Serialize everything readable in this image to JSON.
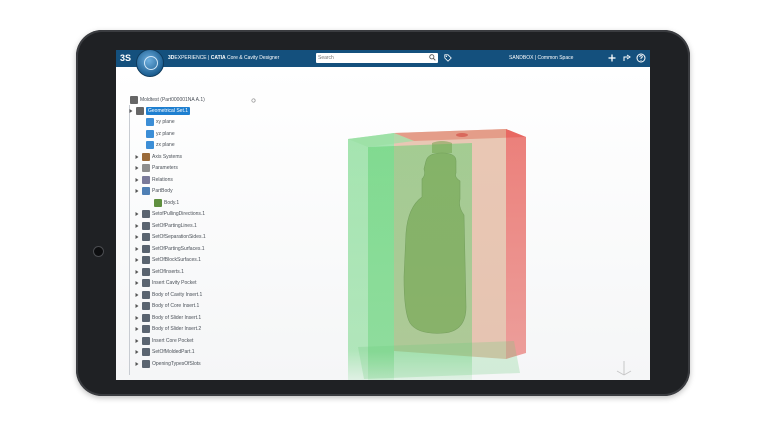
{
  "header": {
    "ds_logo": "3S",
    "brand_3d": "3D",
    "brand_experience": "EXPERIENCE",
    "brand_separator": " | ",
    "brand_catia": "CATIA",
    "brand_app": " Core & Cavity Designer",
    "search_placeholder": "Search",
    "workspace": "SANDBOX | Common Space"
  },
  "tree": {
    "root": "Moldtest (Part000001NA A.1)",
    "selected": "Geometrical Set.1",
    "items": [
      {
        "label": "xy plane",
        "icon": "plane-icon"
      },
      {
        "label": "yz plane",
        "icon": "plane-icon"
      },
      {
        "label": "zx plane",
        "icon": "plane-icon"
      },
      {
        "label": "Axis Systems",
        "icon": "axis-icon"
      },
      {
        "label": "Parameters",
        "icon": "parameters-icon"
      },
      {
        "label": "Relations",
        "icon": "relations-icon"
      },
      {
        "label": "PartBody",
        "icon": "partbody-icon"
      },
      {
        "label": "Body.1",
        "icon": "body-icon"
      },
      {
        "label": "SetofPullingDirections.1",
        "icon": "set-icon"
      },
      {
        "label": "SetOfPartingLines.1",
        "icon": "set-icon"
      },
      {
        "label": "SetOfSeparationSides.1",
        "icon": "set-icon"
      },
      {
        "label": "SetOfPartingSurfaces.1",
        "icon": "set-icon"
      },
      {
        "label": "SetOfBlockSurfaces.1",
        "icon": "set-icon"
      },
      {
        "label": "SetOfInserts.1",
        "icon": "set-icon"
      },
      {
        "label": "Insert Cavity Pocket",
        "icon": "set-icon"
      },
      {
        "label": "Body of Cavity Insert.1",
        "icon": "set-icon"
      },
      {
        "label": "Body of Core Insert.1",
        "icon": "set-icon"
      },
      {
        "label": "Body of Slider Insert.1",
        "icon": "set-icon"
      },
      {
        "label": "Body of Slider Insert.2",
        "icon": "set-icon"
      },
      {
        "label": "Insert Core Pocket",
        "icon": "set-icon"
      },
      {
        "label": "SetOfMoldedPart.1",
        "icon": "set-icon"
      },
      {
        "label": "OpeningTypesOfSlots",
        "icon": "set-icon"
      }
    ]
  },
  "colors": {
    "topbar": "#14507d",
    "selection": "#1e7fd0",
    "cavity_green": "#4fd06a",
    "core_red": "#e4504a"
  }
}
